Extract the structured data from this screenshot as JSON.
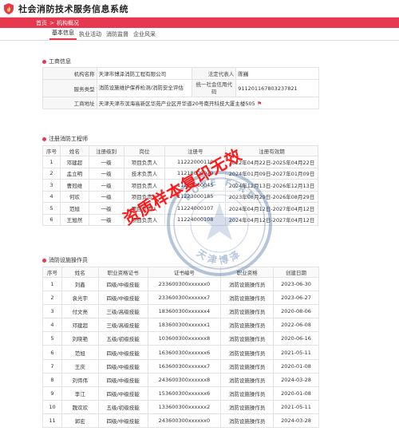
{
  "header": {
    "title": "社会消防技术服务信息系统"
  },
  "breadcrumb": {
    "home": "首页",
    "separator": ">",
    "current": "机构概况"
  },
  "tabs": [
    {
      "label": "基本信息",
      "active": true
    },
    {
      "label": "执业活动",
      "active": false
    },
    {
      "label": "消防监督",
      "active": false
    },
    {
      "label": "企业风采",
      "active": false
    }
  ],
  "business": {
    "section_title": "工商信息",
    "name_label": "机构名称",
    "name_value": "天津市博泽消防工程有限公司",
    "rep_label": "法定代表人",
    "rep_value": "陈巍",
    "type_label": "服务类型",
    "type_value": "消防设施维护保养检测/消防安全评估",
    "credit_label": "统一社会信用代码",
    "credit_value": "911201167803237821",
    "address_label": "工商地址",
    "address_value": "天津天津市滨海高新区华苑产业区开华道20号南开科技大厦主楼505"
  },
  "engineers": {
    "section_title": "注册消防工程师",
    "headers": [
      "序号",
      "姓名",
      "注册级别",
      "岗位",
      "注册号",
      "注册有效期"
    ],
    "rows": [
      [
        "1",
        "邓建超",
        "一级",
        "项目负责人",
        "11222000110",
        "2022年04月22日-2025年04月22日"
      ],
      [
        "2",
        "孟立明",
        "一级",
        "技术负责人",
        "11218000079",
        "2024年01月09日-2027年01月09日"
      ],
      [
        "3",
        "曹冠维",
        "一级",
        "项目负责人",
        "11224000045",
        "2024年12月13日-2026年12月13日"
      ],
      [
        "4",
        "何欢",
        "一级",
        "项目负责人",
        "11223000185",
        "2023年08月29日-2026年08月29日"
      ],
      [
        "5",
        "范旭",
        "一级",
        "项目负责人",
        "11224000107",
        "2024年04月12日-2027年04月12日"
      ],
      [
        "6",
        "王旭然",
        "一级",
        "项目负责人",
        "11224000108",
        "2024年04月12日-2027年04月12日"
      ]
    ]
  },
  "operators": {
    "section_title": "消防设施操作员",
    "headers": [
      "序号",
      "姓名",
      "职业资格证书",
      "证书编号",
      "职业资格",
      "创建日期"
    ],
    "rows": [
      [
        "1",
        "刘鑫",
        "四级/中级技能",
        "233600300xxxxxx0",
        "消防设施操作员",
        "2023-06-30"
      ],
      [
        "2",
        "袁光宇",
        "四级/中级技能",
        "233600300xxxxxx7",
        "消防设施操作员",
        "2023-06-27"
      ],
      [
        "3",
        "付文亮",
        "三级/高级技能",
        "183600300xxxxxx4",
        "消防设施操作员",
        "2020-08-06"
      ],
      [
        "4",
        "邓建超",
        "三级/高级技能",
        "183600300xxxxxx1",
        "消防设施操作员",
        "2022-06-08"
      ],
      [
        "5",
        "刘晓艳",
        "五级/初级技能",
        "103600300xxxxxx8",
        "消防设施操作员",
        "2020-06-16"
      ],
      [
        "6",
        "范旭",
        "四级/中级技能",
        "163600300xxxxxx6",
        "消防设施操作员",
        "2021-05-11"
      ],
      [
        "7",
        "王庆",
        "四级/中级技能",
        "163600300xxxxxx7",
        "消防设施操作员",
        "2020-01-08"
      ],
      [
        "8",
        "刘伟伟",
        "四级/中级技能",
        "243600300xxxxxx8",
        "消防设施操作员",
        "2024-03-28"
      ],
      [
        "9",
        "李江",
        "四级/中级技能",
        "153600300xxxxxx6",
        "消防设施操作员",
        "2020-01-08"
      ],
      [
        "10",
        "魏欢欢",
        "五级/初级技能",
        "133600300xxxxxx2",
        "消防设施操作员",
        "2021-05-11"
      ],
      [
        "11",
        "郭宏",
        "四级/中级技能",
        "243600300xxxxxx0",
        "消防设施操作员",
        "2024-03-28"
      ]
    ]
  },
  "overlay": {
    "watermark_text": "资质样本复印无效",
    "seal_top_text": "BOZE FIRE",
    "seal_bottom_text": "天津博泽"
  },
  "colors": {
    "accent": "#e8384f",
    "watermark": "#ff1a1a",
    "seal": "#2b5a94"
  }
}
